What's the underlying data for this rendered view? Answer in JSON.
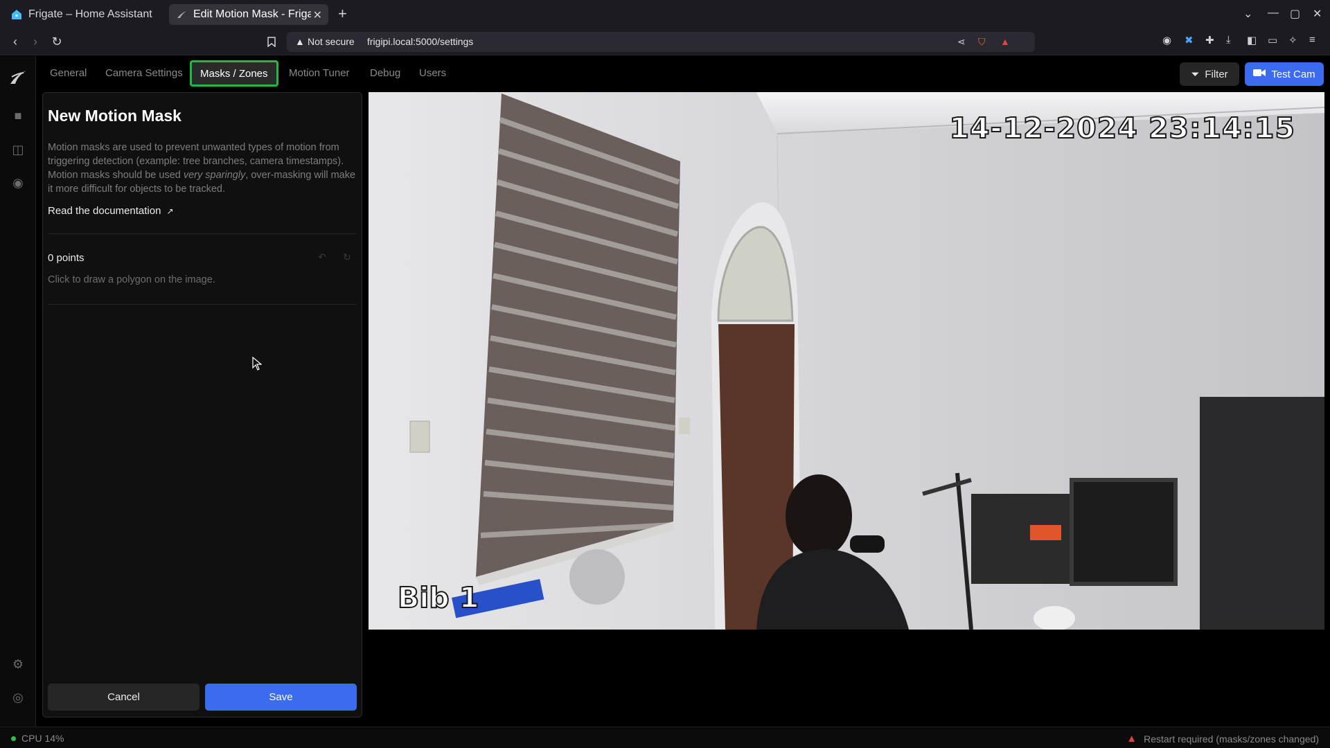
{
  "browser": {
    "tabs": [
      {
        "label": "Frigate – Home Assistant",
        "icon": "home-assistant-icon"
      },
      {
        "label": "Edit Motion Mask - Frigate",
        "icon": "frigate-icon"
      }
    ],
    "url": {
      "security": "Not secure",
      "address": "frigipi.local:5000/settings"
    }
  },
  "app": {
    "nav_tabs": [
      "General",
      "Camera Settings",
      "Masks / Zones",
      "Motion Tuner",
      "Debug",
      "Users"
    ],
    "active_tab": "Masks / Zones",
    "filter_label": "Filter",
    "testcam_label": "Test Cam"
  },
  "panel": {
    "title": "New Motion Mask",
    "desc_part1": "Motion masks are used to prevent unwanted types of motion from triggering detection (example: tree branches, camera timestamps). Motion masks should be used ",
    "desc_em": "very sparingly",
    "desc_part2": ", over-masking will make it more difficult for objects to be tracked.",
    "doc_link": "Read the documentation",
    "points": "0 points",
    "hint": "Click to draw a polygon on the image.",
    "cancel": "Cancel",
    "save": "Save"
  },
  "camera": {
    "timestamp": "14-12-2024 23:14:15",
    "name": "Bib 1"
  },
  "status": {
    "cpu": "CPU 14%",
    "restart": "Restart required (masks/zones changed)"
  },
  "colors": {
    "accent": "#3b6cf0",
    "active_border": "#1dbb45",
    "warning": "#e04040"
  }
}
